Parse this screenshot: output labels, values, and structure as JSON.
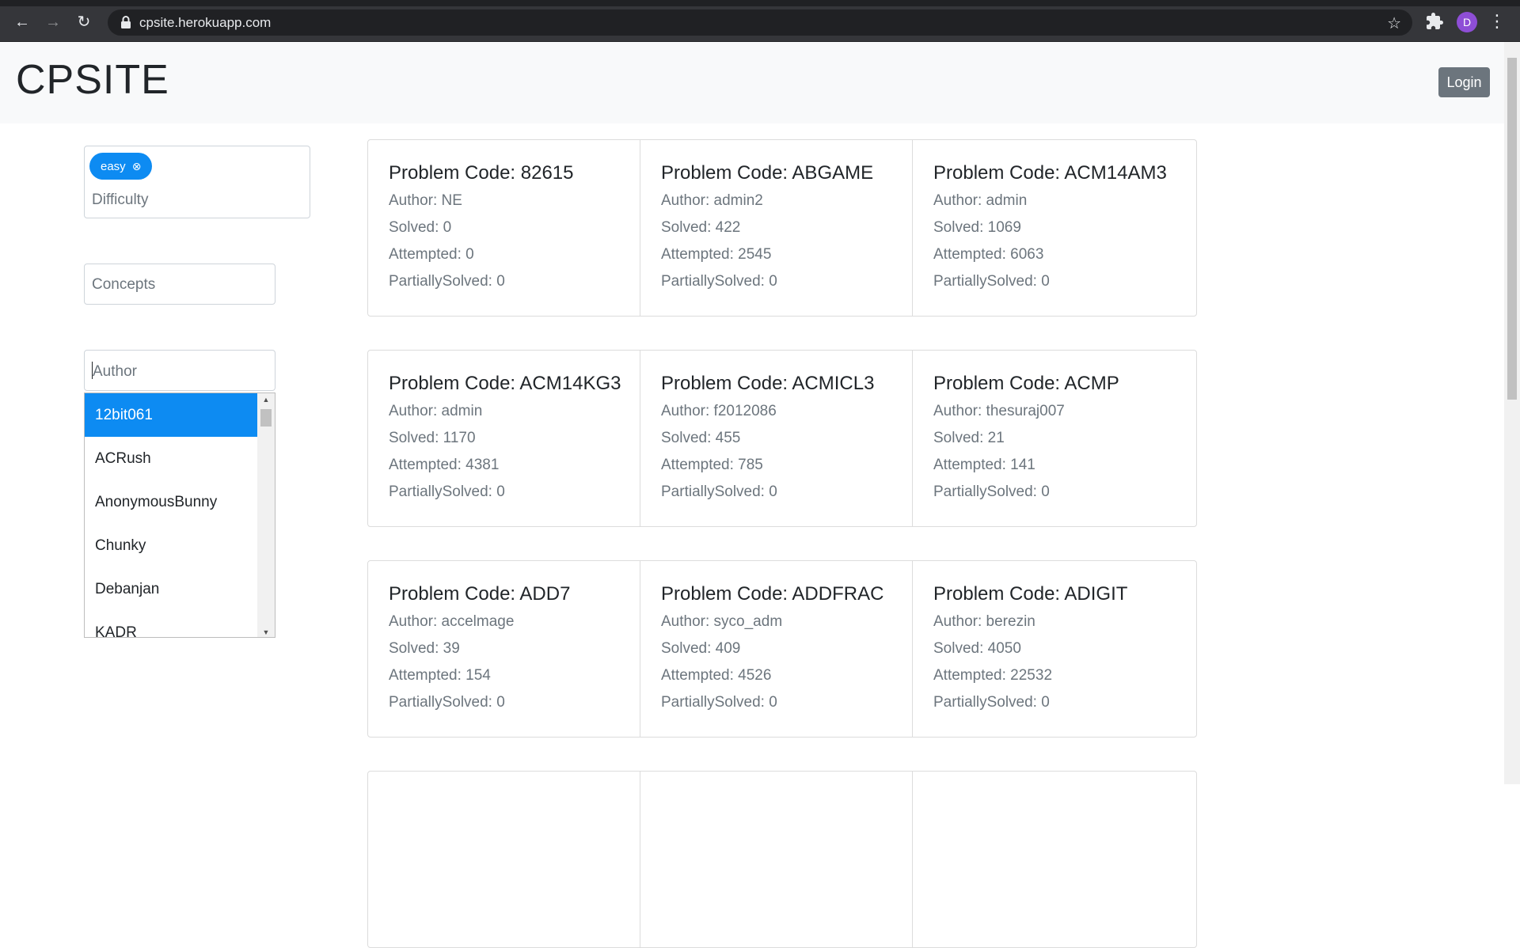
{
  "browser": {
    "url": "cpsite.herokuapp.com",
    "profile_initial": "D",
    "icons": [
      "back-icon",
      "forward-icon",
      "reload-icon",
      "lock-icon",
      "bookmark-star-icon",
      "extensions-icon",
      "menu-dots-icon"
    ]
  },
  "header": {
    "brand": "CPSITE",
    "login_label": "Login"
  },
  "filters": {
    "difficulty": {
      "chip_label": "easy",
      "chip_close": "⊗",
      "placeholder": "Difficulty"
    },
    "concepts": {
      "placeholder": "Concepts"
    },
    "author": {
      "placeholder": "Author",
      "options": [
        "12bit061",
        "ACRush",
        "AnonymousBunny",
        "Chunky",
        "Debanjan",
        "KADR"
      ],
      "selected_index": 0
    }
  },
  "labels": {
    "problem_code": "Problem Code: ",
    "author": "Author: ",
    "solved": "Solved: ",
    "attempted": "Attempted: ",
    "partially": "PartiallySolved: "
  },
  "problems": [
    {
      "code": "82615",
      "author": "NE",
      "solved": "0",
      "attempted": "0",
      "partially": "0"
    },
    {
      "code": "ABGAME",
      "author": "admin2",
      "solved": "422",
      "attempted": "2545",
      "partially": "0"
    },
    {
      "code": "ACM14AM3",
      "author": "admin",
      "solved": "1069",
      "attempted": "6063",
      "partially": "0"
    },
    {
      "code": "ACM14KG3",
      "author": "admin",
      "solved": "1170",
      "attempted": "4381",
      "partially": "0"
    },
    {
      "code": "ACMICL3",
      "author": "f2012086",
      "solved": "455",
      "attempted": "785",
      "partially": "0"
    },
    {
      "code": "ACMP",
      "author": "thesuraj007",
      "solved": "21",
      "attempted": "141",
      "partially": "0"
    },
    {
      "code": "ADD7",
      "author": "accelmage",
      "solved": "39",
      "attempted": "154",
      "partially": "0"
    },
    {
      "code": "ADDFRAC",
      "author": "syco_adm",
      "solved": "409",
      "attempted": "4526",
      "partially": "0"
    },
    {
      "code": "ADIGIT",
      "author": "berezin",
      "solved": "4050",
      "attempted": "22532",
      "partially": "0"
    }
  ]
}
